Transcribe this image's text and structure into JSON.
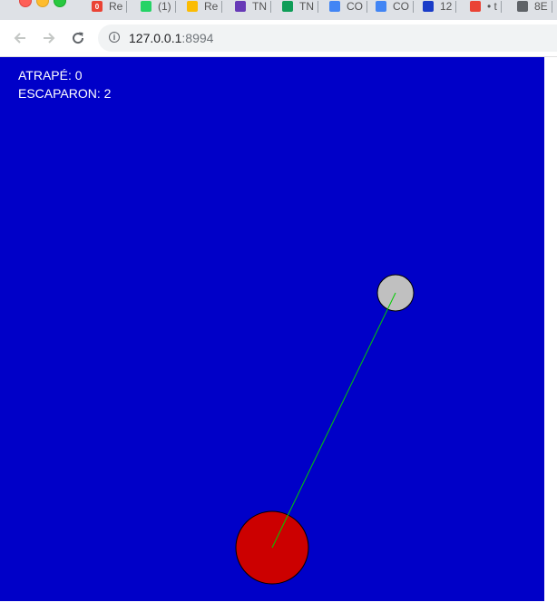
{
  "browser": {
    "tabs": [
      {
        "title": "Re",
        "icon": "gmail-icon",
        "color": "#ea4335",
        "badge": "0"
      },
      {
        "title": "(1)",
        "icon": "whatsapp-icon",
        "color": "#25d366"
      },
      {
        "title": "Re",
        "icon": "google-drive-icon",
        "color": "#fbbc04"
      },
      {
        "title": "TN",
        "icon": "google-forms-icon",
        "color": "#673ab7"
      },
      {
        "title": "TN",
        "icon": "google-sheets-icon",
        "color": "#0f9d58"
      },
      {
        "title": "CO",
        "icon": "google-docs-icon",
        "color": "#4285f4"
      },
      {
        "title": "CO",
        "icon": "google-docs-icon",
        "color": "#4285f4"
      },
      {
        "title": "12",
        "icon": "circle-icon",
        "color": "#1a3cc8"
      },
      {
        "title": "• t",
        "icon": "google-notify-icon",
        "color": "#ea4335"
      },
      {
        "title": "8E",
        "icon": "globe-icon",
        "color": "#5f6368"
      }
    ],
    "url_host": "127.0.0.1",
    "url_port": ":8994"
  },
  "game": {
    "background": "#0000c8",
    "hud": {
      "caught_label": "ATRAPÉ: 0",
      "escaped_label": "ESCAPARON: 2"
    },
    "player": {
      "color": "#cc0000"
    },
    "target": {
      "color": "#c0c0c0"
    },
    "tether": {
      "color": "#00cc00"
    }
  }
}
